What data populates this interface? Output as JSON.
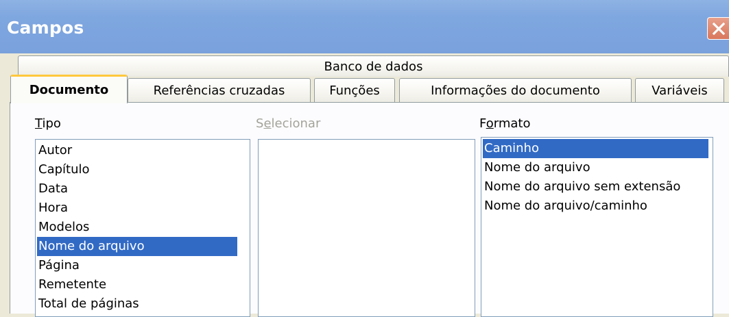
{
  "window": {
    "title": "Campos"
  },
  "tabs": {
    "row_top": [
      {
        "label": "Banco de dados",
        "active": false
      }
    ],
    "row_bottom": [
      {
        "label": "Documento",
        "active": true
      },
      {
        "label": "Referências cruzadas",
        "active": false
      },
      {
        "label": "Funções",
        "active": false
      },
      {
        "label": "Informações do documento",
        "active": false
      },
      {
        "label": "Variáveis",
        "active": false
      }
    ]
  },
  "tipo": {
    "label_accel": "T",
    "label_rest": "ipo",
    "items": [
      "Autor",
      "Capítulo",
      "Data",
      "Hora",
      "Modelos",
      "Nome do arquivo",
      "Página",
      "Remetente",
      "Total de páginas"
    ],
    "selected": "Nome do arquivo"
  },
  "selecionar": {
    "label_pre": "S",
    "label_accel": "e",
    "label_rest": "lecionar",
    "enabled": false,
    "items": []
  },
  "formato": {
    "label_pre": "F",
    "label_accel": "o",
    "label_rest": "rmato",
    "items": [
      "Caminho",
      "Nome do arquivo",
      "Nome do arquivo sem extensão",
      "Nome do arquivo/caminho"
    ],
    "selected": "Caminho"
  },
  "colors": {
    "titlebar": "#7ea6df",
    "dialog_bg": "#ece9d8",
    "selection": "#316ac5",
    "active_tab_accent": "#ffc83c",
    "disabled_text": "#a4a39a"
  },
  "icons": {
    "close": "close-icon"
  }
}
